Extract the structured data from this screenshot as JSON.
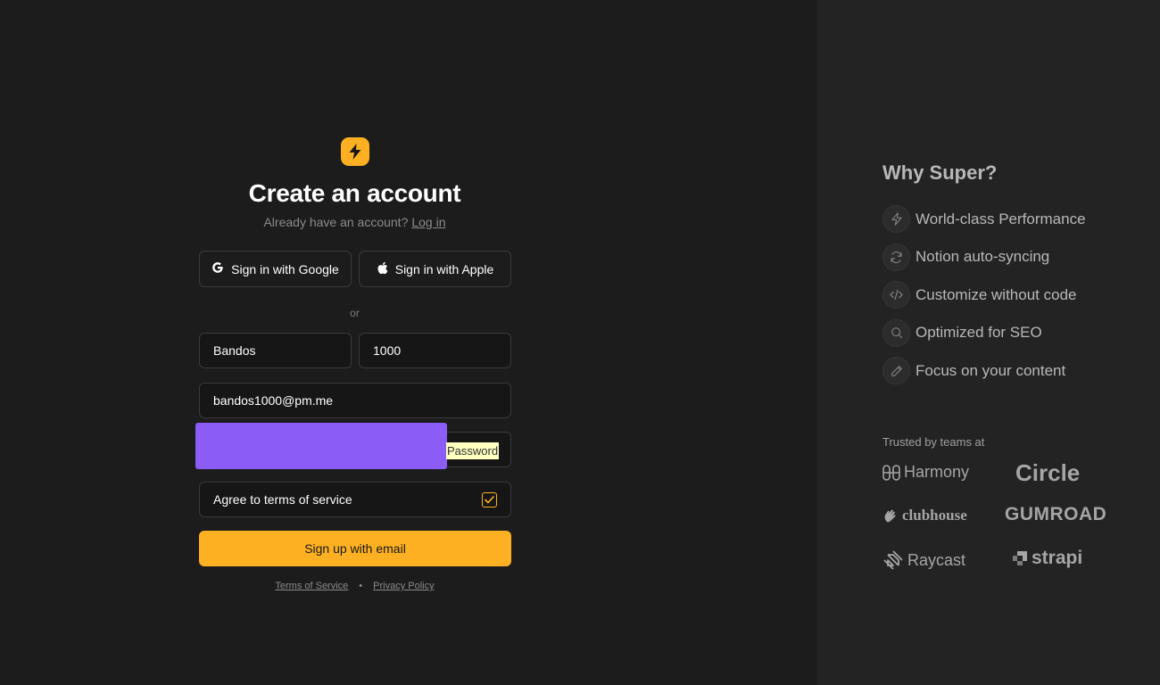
{
  "signup": {
    "title": "Create an account",
    "subtitle": "Already have an account?",
    "login_link": "Log in",
    "google_button": "Sign in with Google",
    "apple_button": "Sign in with Apple",
    "divider": "or",
    "first_name_value": "Bandos",
    "last_name_value": "1000",
    "email_value": "bandos1000@pm.me",
    "password_label": "Password",
    "terms_label": "Agree to terms of service",
    "terms_checked": true,
    "submit_button": "Sign up with email",
    "footer": {
      "terms_link": "Terms of Service",
      "separator": "•",
      "privacy_link": "Privacy Policy"
    }
  },
  "sidebar": {
    "title": "Why Super?",
    "features": [
      {
        "label": "World-class Performance",
        "icon": "lightning-icon"
      },
      {
        "label": "Notion auto-syncing",
        "icon": "sync-icon"
      },
      {
        "label": "Customize without code",
        "icon": "code-icon"
      },
      {
        "label": "Optimized for SEO",
        "icon": "search-icon"
      },
      {
        "label": "Focus on your content",
        "icon": "pencil-icon"
      }
    ],
    "trusted_label": "Trusted by teams at",
    "brands": [
      "Harmony",
      "Circle",
      "clubhouse",
      "GUMROAD",
      "Raycast",
      "strapi"
    ]
  },
  "colors": {
    "accent": "#fdb022",
    "overlay": "#8b5cf6",
    "background": "#1c1c1c",
    "sidebar_bg": "#232323"
  }
}
